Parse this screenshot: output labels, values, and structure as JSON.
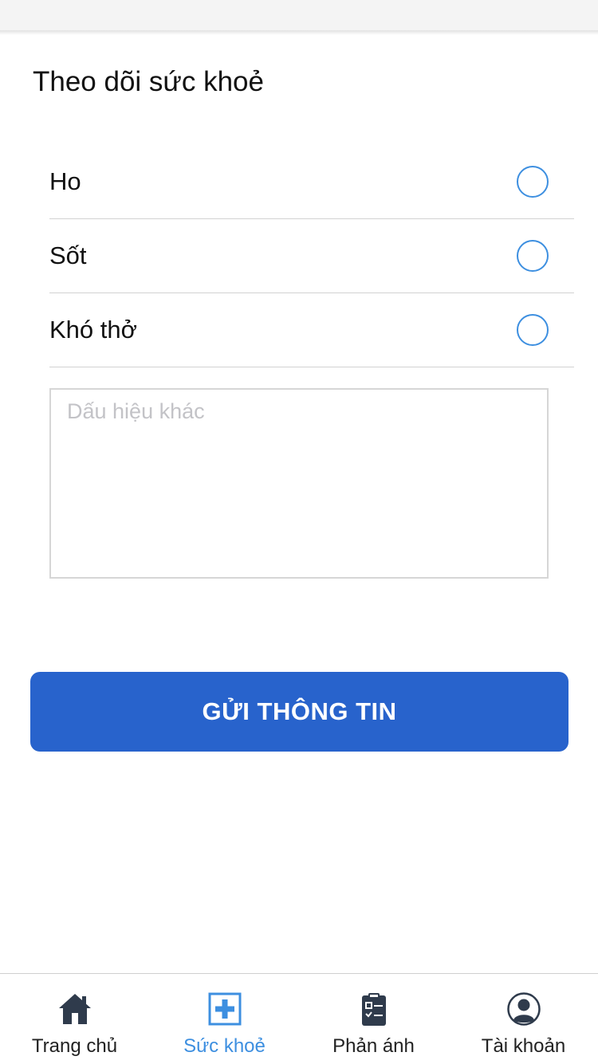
{
  "screen": {
    "title": "Theo dõi sức khoẻ"
  },
  "symptoms": [
    {
      "label": "Ho",
      "checked": false
    },
    {
      "label": "Sốt",
      "checked": false
    },
    {
      "label": "Khó thở",
      "checked": false
    }
  ],
  "other_signs": {
    "value": "",
    "placeholder": "Dấu hiệu khác"
  },
  "submit_label": "GỬI THÔNG TIN",
  "tabs": [
    {
      "label": "Trang chủ",
      "icon": "home-icon",
      "active": false
    },
    {
      "label": "Sức khoẻ",
      "icon": "medical-plus-icon",
      "active": true
    },
    {
      "label": "Phản ánh",
      "icon": "clipboard-checklist-icon",
      "active": false
    },
    {
      "label": "Tài khoản",
      "icon": "account-circle-icon",
      "active": false
    }
  ],
  "colors": {
    "accent": "#3d8fe0",
    "button": "#2863cc",
    "icon_dark": "#2f3b4c",
    "divider": "#d2d2d2"
  }
}
